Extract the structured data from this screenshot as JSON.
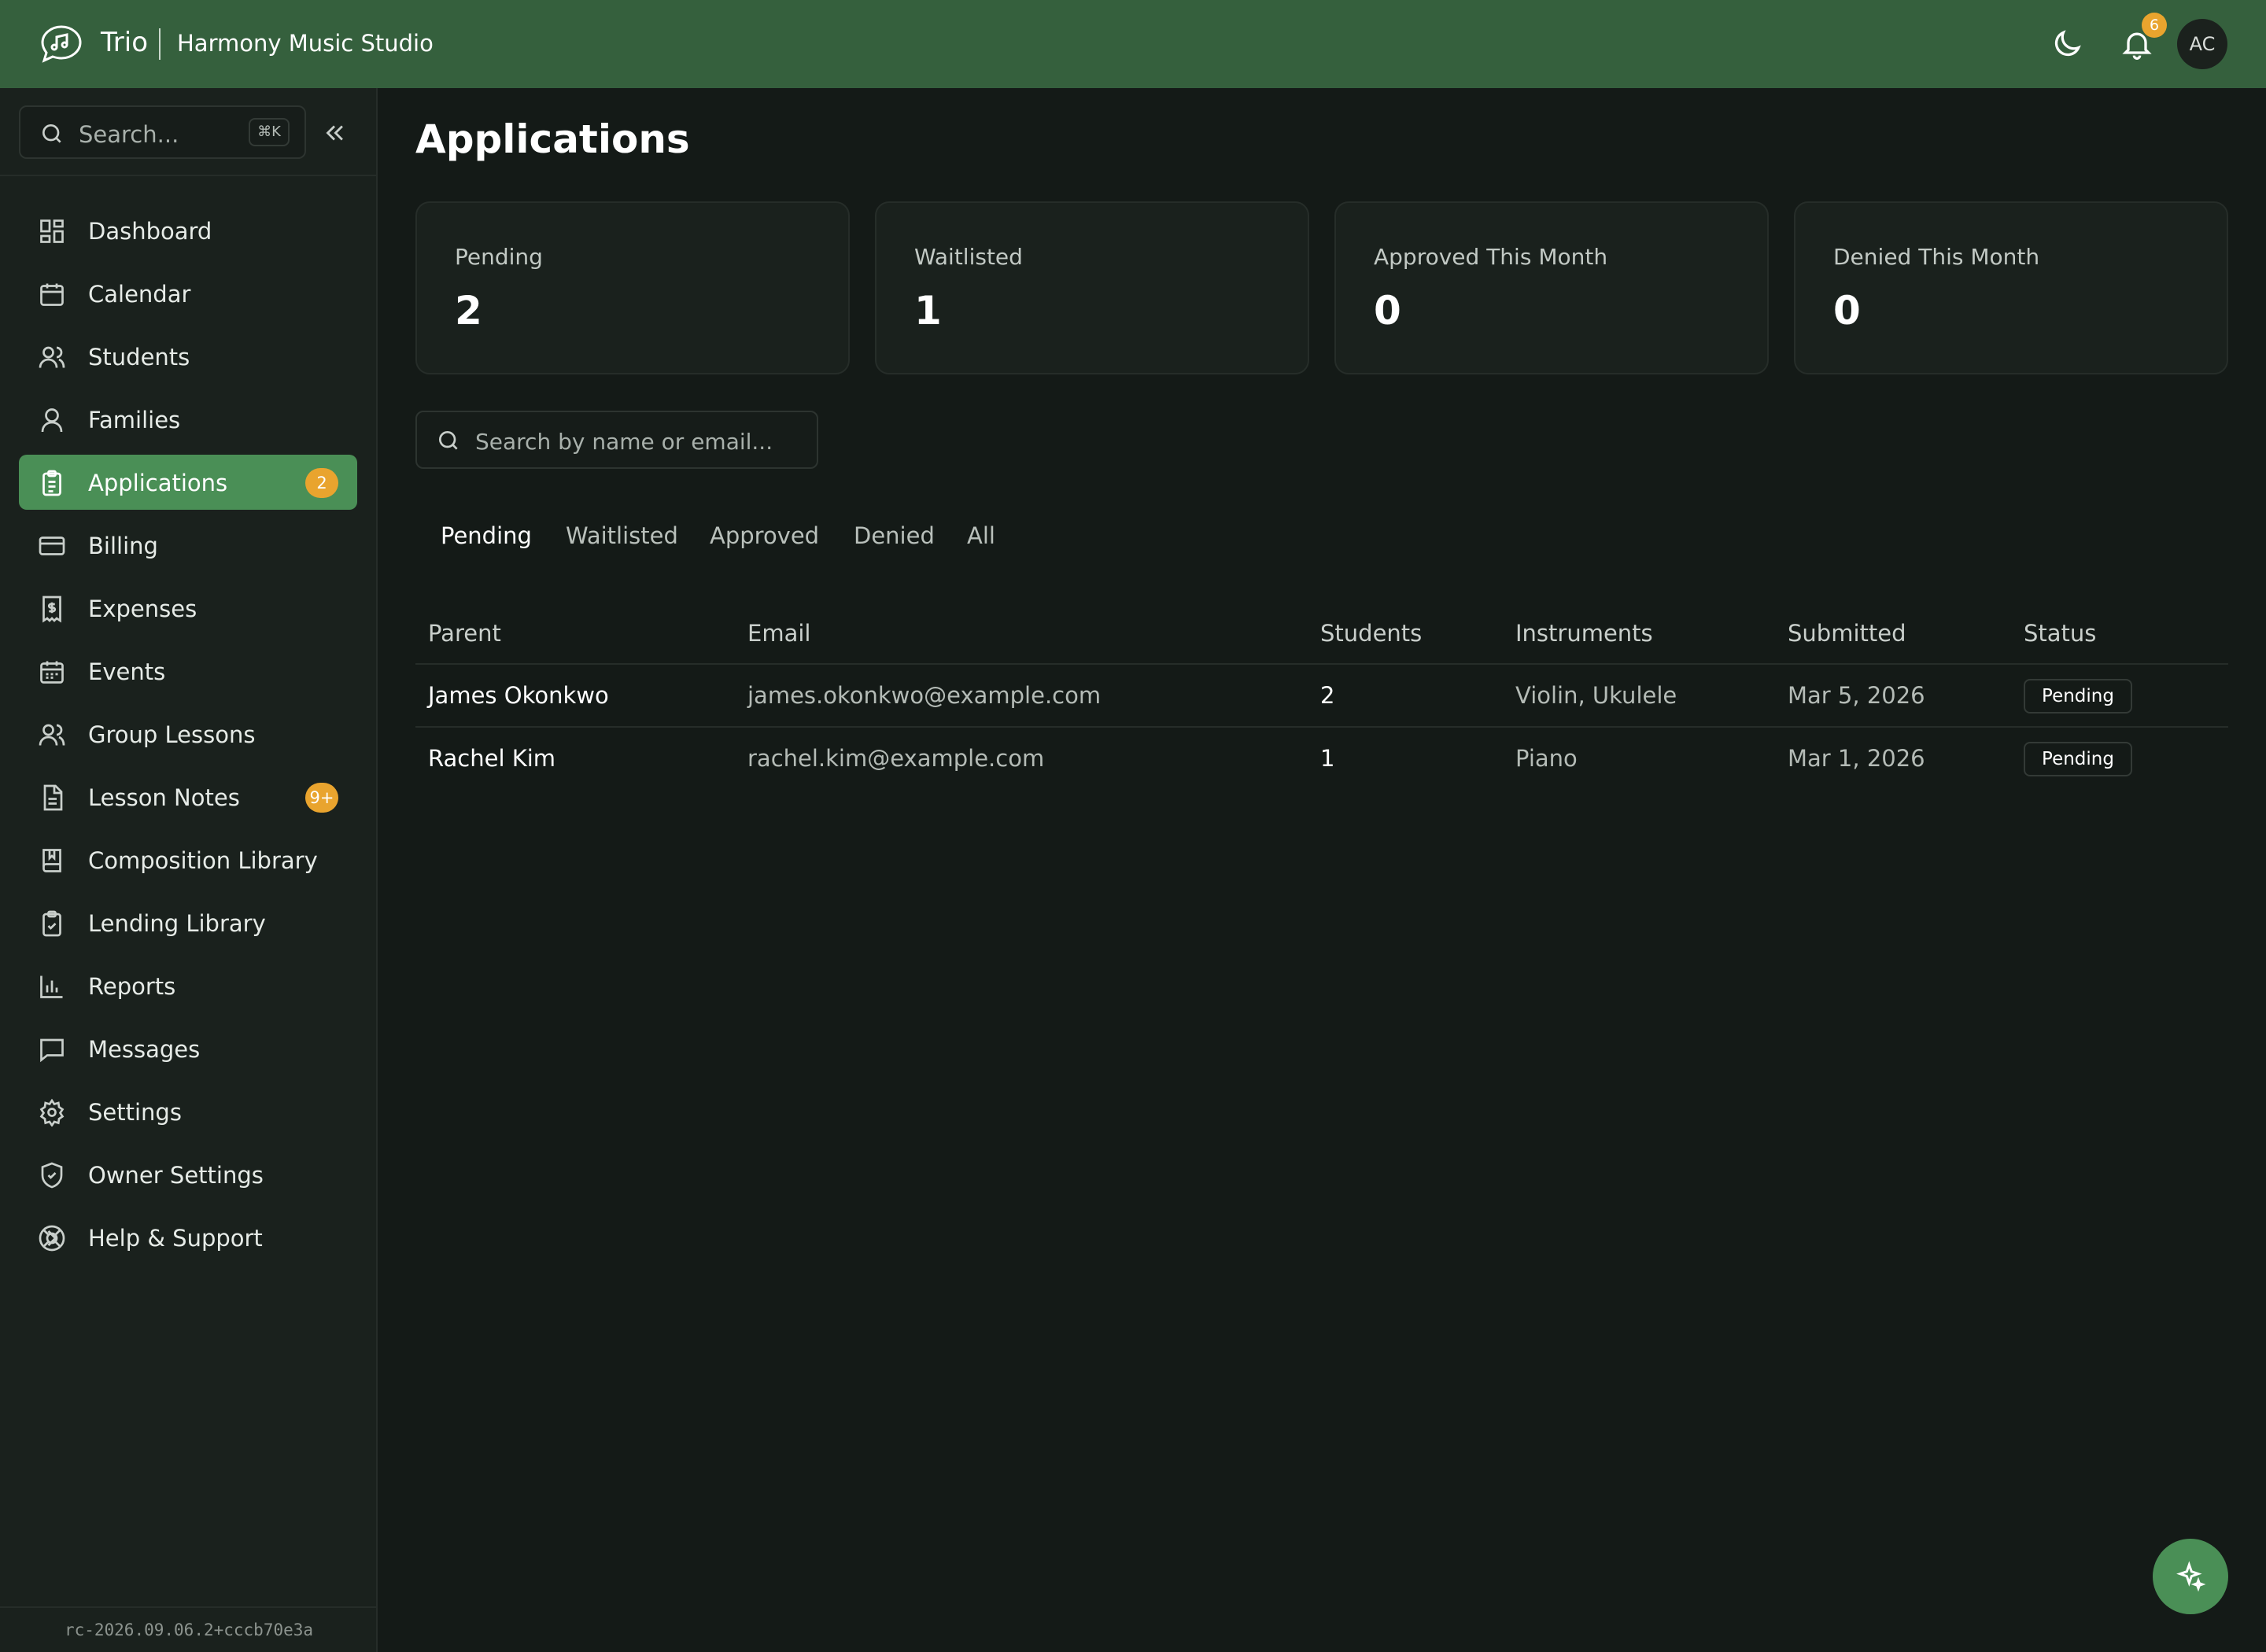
{
  "header": {
    "brand": "Trio",
    "studio": "Harmony Music Studio",
    "notification_count": "6",
    "avatar_initials": "AC",
    "accent_color": "#35603d"
  },
  "sidebar": {
    "search_placeholder": "Search...",
    "search_shortcut": "⌘K",
    "items": [
      {
        "label": "Dashboard",
        "icon": "dashboard-icon"
      },
      {
        "label": "Calendar",
        "icon": "calendar-icon"
      },
      {
        "label": "Students",
        "icon": "students-icon"
      },
      {
        "label": "Families",
        "icon": "person-icon"
      },
      {
        "label": "Applications",
        "icon": "clipboard-icon",
        "badge": "2",
        "active": true
      },
      {
        "label": "Billing",
        "icon": "credit-card-icon"
      },
      {
        "label": "Expenses",
        "icon": "receipt-icon"
      },
      {
        "label": "Events",
        "icon": "calendar-grid-icon"
      },
      {
        "label": "Group Lessons",
        "icon": "group-icon"
      },
      {
        "label": "Lesson Notes",
        "icon": "document-icon",
        "badge": "9+"
      },
      {
        "label": "Composition Library",
        "icon": "book-icon"
      },
      {
        "label": "Lending Library",
        "icon": "clipboard-check-icon"
      },
      {
        "label": "Reports",
        "icon": "bar-chart-icon"
      },
      {
        "label": "Messages",
        "icon": "message-icon"
      },
      {
        "label": "Settings",
        "icon": "gear-icon"
      },
      {
        "label": "Owner Settings",
        "icon": "shield-icon"
      },
      {
        "label": "Help & Support",
        "icon": "lifebuoy-icon"
      }
    ],
    "version": "rc-2026.09.06.2+cccb70e3a"
  },
  "main": {
    "title": "Applications",
    "stats": [
      {
        "label": "Pending",
        "value": "2"
      },
      {
        "label": "Waitlisted",
        "value": "1"
      },
      {
        "label": "Approved This Month",
        "value": "0"
      },
      {
        "label": "Denied This Month",
        "value": "0"
      }
    ],
    "search_placeholder": "Search by name or email...",
    "tabs": [
      "Pending",
      "Waitlisted",
      "Approved",
      "Denied",
      "All"
    ],
    "active_tab": "Pending",
    "table": {
      "headers": [
        "Parent",
        "Email",
        "Students",
        "Instruments",
        "Submitted",
        "Status"
      ],
      "rows": [
        {
          "parent": "James Okonkwo",
          "email": "james.okonkwo@example.com",
          "students": "2",
          "instruments": "Violin, Ukulele",
          "submitted": "Mar 5, 2026",
          "status": "Pending"
        },
        {
          "parent": "Rachel Kim",
          "email": "rachel.kim@example.com",
          "students": "1",
          "instruments": "Piano",
          "submitted": "Mar 1, 2026",
          "status": "Pending"
        }
      ]
    }
  }
}
